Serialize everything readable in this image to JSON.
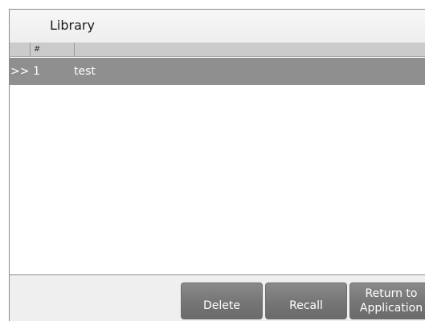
{
  "header": {
    "title": "Library"
  },
  "table": {
    "columns": [
      "",
      "#",
      ""
    ],
    "rows": [
      {
        "marker": ">>",
        "number": "1",
        "name": "test"
      }
    ]
  },
  "footer": {
    "delete_label": "Delete",
    "recall_label": "Recall",
    "return_label_line1": "Return to",
    "return_label_line2": "Application"
  },
  "colors": {
    "selected_row": "#8f8f8f",
    "button": "#777777",
    "header_row": "#cbcbcb"
  }
}
